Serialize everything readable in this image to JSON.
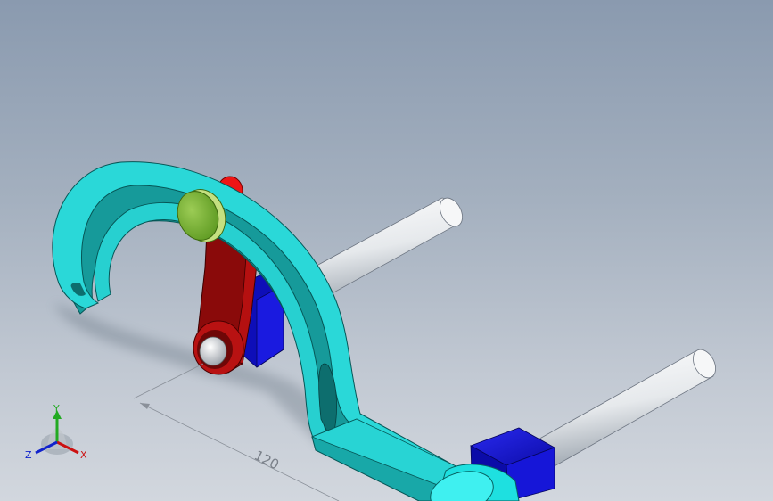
{
  "viewport": {
    "background_top": "#8a9aaf",
    "background_bottom": "#d2d7de"
  },
  "model": {
    "colors": {
      "fork": "#27d3d3",
      "fork_side": "#169a9a",
      "shaft": "#eef0f2",
      "block": "#1010cc",
      "lever": "#8a0a0a",
      "pin_red": "#ee1111",
      "cap_green": "#7fb63a"
    }
  },
  "dimension": {
    "value": "120"
  },
  "triad": {
    "x_label": "X",
    "y_label": "Y",
    "z_label": "Z",
    "x_color": "#cc1111",
    "y_color": "#22aa22",
    "z_color": "#1122cc"
  }
}
